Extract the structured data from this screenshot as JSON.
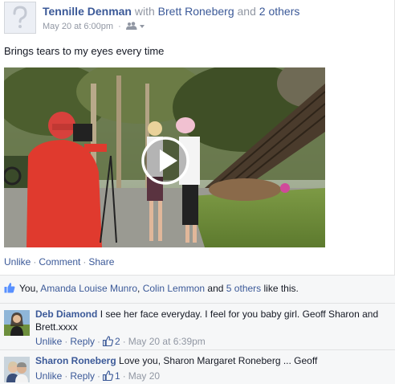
{
  "post": {
    "author": "Tennille Denman",
    "with_word": "with",
    "tagged_person": "Brett Roneberg",
    "and_word": "and",
    "others_link": "2 others",
    "timestamp": "May 20 at 6:00pm",
    "meta_sep": "·",
    "audience_icon": "friends-icon",
    "text": "Brings tears to my eyes every time"
  },
  "video": {
    "play_icon": "play-icon"
  },
  "actions": {
    "unlike": "Unlike",
    "comment": "Comment",
    "share": "Share",
    "sep": "·"
  },
  "likes": {
    "you": "You,",
    "person1": "Amanda Louise Munro",
    "comma": ",",
    "person2": "Colin Lemmon",
    "and": "and",
    "others": "5 others",
    "suffix": "like this."
  },
  "comments": [
    {
      "author": "Deb Diamond",
      "text": "I see her face everyday. I feel for you baby girl. Geoff Sharon and Brett.xxxx",
      "unlike": "Unlike",
      "reply": "Reply",
      "likes": "2",
      "time": "May 20 at 6:39pm",
      "sep": "·"
    },
    {
      "author": "Sharon Roneberg",
      "text": "Love you, Sharon Margaret Roneberg ... Geoff",
      "unlike": "Unlike",
      "reply": "Reply",
      "likes": "1",
      "time": "May 20",
      "sep": "·"
    }
  ],
  "colors": {
    "link": "#3b5998",
    "meta": "#9197a3",
    "ufi_bg": "#f6f7f8"
  }
}
